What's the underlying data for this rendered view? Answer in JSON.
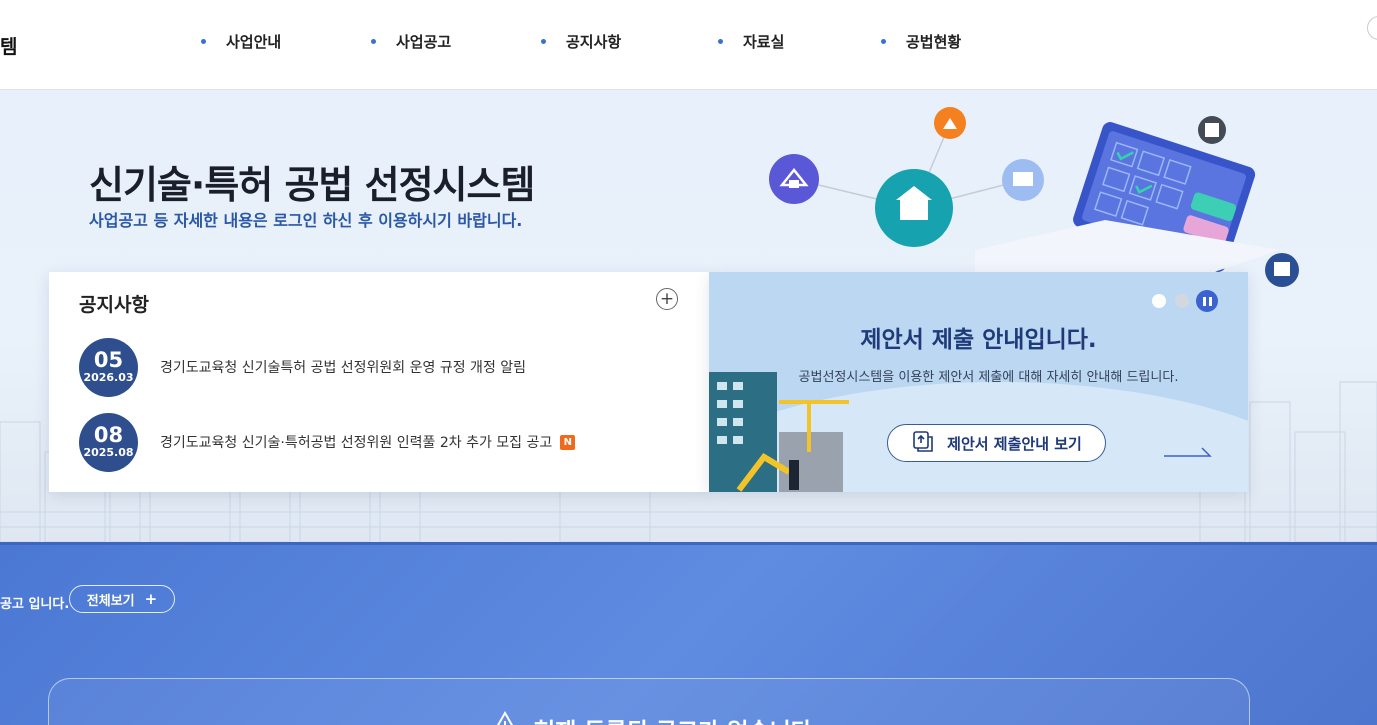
{
  "header": {
    "logo_fragment": "템",
    "nav": [
      "사업안내",
      "사업공고",
      "공지사항",
      "자료실",
      "공법현황"
    ]
  },
  "hero": {
    "title": "신기술·특허 공법 선정시스템",
    "subtitle": "사업공고 등 자세한 내용은 로그인 하신 후 이용하시기 바랍니다."
  },
  "notice": {
    "title": "공지사항",
    "more_symbol": "+",
    "items": [
      {
        "day": "05",
        "ym": "2026.03",
        "text": "경기도교육청 신기술특허 공법 선정위원회 운영 규정 개정 알림",
        "new": ""
      },
      {
        "day": "08",
        "ym": "2025.08",
        "text": "경기도교육청 신기술·특허공법 선정위원 인력풀 2차 추가 모집 공고",
        "new": "N"
      }
    ]
  },
  "banner": {
    "title": "제안서 제출 안내입니다.",
    "description": "공법선정시스템을 이용한 제안서 제출에 대해 자세히 안내해 드립니다.",
    "button": "제안서 제출안내 보기"
  },
  "announcements": {
    "lead_text": "공고 입니다.",
    "view_all": "전체보기",
    "view_all_symbol": "+",
    "empty_message": "현재 등록된 공고가 없습니다"
  },
  "colors": {
    "accent": "#3b6fd8",
    "badge": "#2f4e8e",
    "new_badge": "#f06a1d",
    "section_blue": "#5a86de"
  }
}
